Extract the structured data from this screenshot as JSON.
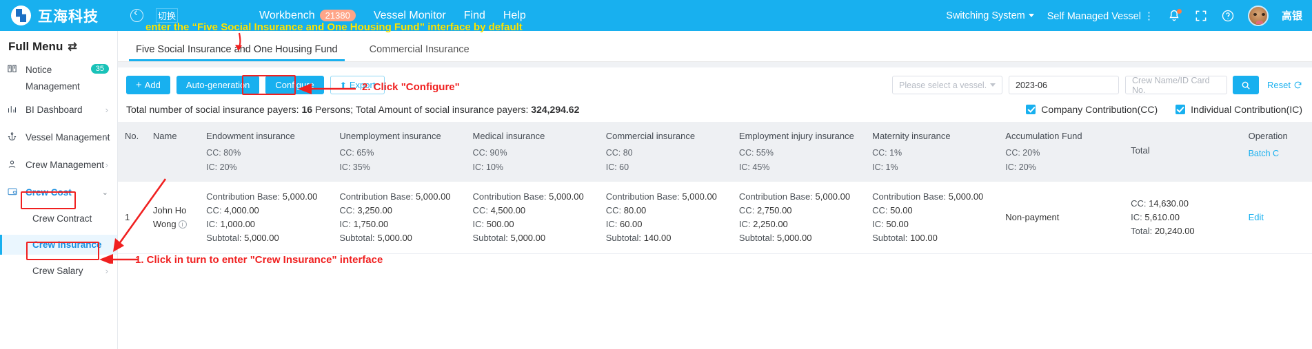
{
  "topbar": {
    "logo_text": "互海科技",
    "switch_label": "切换",
    "nav": [
      {
        "label": "Workbench",
        "badge": "21380"
      },
      {
        "label": "Vessel Monitor",
        "badge": ""
      },
      {
        "label": "Find",
        "badge": ""
      },
      {
        "label": "Help",
        "badge": ""
      }
    ],
    "switching_system": "Switching System",
    "self_managed_vessel": "Self Managed Vessel",
    "user_name": "高银"
  },
  "sidebar": {
    "title": "Full Menu",
    "items": [
      {
        "label": "Notice",
        "label2": "Management",
        "badge": "35",
        "icon": "book-icon",
        "chevron": ""
      },
      {
        "label": "BI Dashboard",
        "badge": "",
        "icon": "chart-icon",
        "chevron": "right"
      },
      {
        "label": "Vessel Management",
        "badge": "",
        "icon": "anchor-icon",
        "chevron": "right"
      },
      {
        "label": "Crew Management",
        "badge": "",
        "icon": "person-icon",
        "chevron": "right"
      },
      {
        "label": "Crew Cost",
        "badge": "",
        "icon": "wallet-icon",
        "chevron": "down"
      }
    ],
    "sub_items": [
      {
        "label": "Crew Contract",
        "chevron": ""
      },
      {
        "label": "Crew Insurance",
        "chevron": ""
      },
      {
        "label": "Crew Salary",
        "chevron": "right"
      }
    ]
  },
  "tabs": [
    {
      "label": "Five Social Insurance and One Housing Fund",
      "active": true
    },
    {
      "label": "Commercial Insurance",
      "active": false
    }
  ],
  "toolbar": {
    "add_label": "Add",
    "auto_generation_label": "Auto-generation",
    "configure_label": "Configure",
    "export_label": "Export",
    "vessel_placeholder": "Please select a vessel.",
    "date_value": "2023-06",
    "crew_placeholder": "Crew Name/ID Card No.",
    "reset_label": "Reset"
  },
  "summary": {
    "text_a": "Total number of social insurance payers:",
    "count": "16",
    "text_b": "Persons; Total Amount of social insurance payers:",
    "amount": "324,294.62",
    "company_contribution": "Company Contribution(CC)",
    "individual_contribution": "Individual Contribution(IC)"
  },
  "table": {
    "columns": [
      {
        "title": "No.",
        "sub1": "",
        "sub2": ""
      },
      {
        "title": "Name",
        "sub1": "",
        "sub2": ""
      },
      {
        "title": "Endowment insurance",
        "sub1": "CC: 80%",
        "sub2": "IC: 20%"
      },
      {
        "title": "Unemployment insurance",
        "sub1": "CC: 65%",
        "sub2": "IC: 35%"
      },
      {
        "title": "Medical insurance",
        "sub1": "CC: 90%",
        "sub2": "IC: 10%"
      },
      {
        "title": "Commercial insurance",
        "sub1": "CC: 80",
        "sub2": "IC: 60"
      },
      {
        "title": "Employment injury insurance",
        "sub1": "CC: 55%",
        "sub2": "IC: 45%"
      },
      {
        "title": "Maternity insurance",
        "sub1": "CC: 1%",
        "sub2": "IC: 1%"
      },
      {
        "title": "Accumulation Fund",
        "sub1": "CC: 20%",
        "sub2": "IC: 20%"
      },
      {
        "title": "Total",
        "sub1": "",
        "sub2": ""
      },
      {
        "title": "Operation",
        "sub1": "Batch C",
        "sub2": ""
      }
    ],
    "rows": [
      {
        "no": "1",
        "name": "John Ho Wong",
        "endowment": {
          "base_k": "Contribution Base:",
          "base_v": "5,000.00",
          "cc_k": "CC:",
          "cc_v": "4,000.00",
          "ic_k": "IC:",
          "ic_v": "1,000.00",
          "sub_k": "Subtotal:",
          "sub_v": "5,000.00"
        },
        "unemployment": {
          "base_k": "Contribution Base:",
          "base_v": "5,000.00",
          "cc_k": "CC:",
          "cc_v": "3,250.00",
          "ic_k": "IC:",
          "ic_v": "1,750.00",
          "sub_k": "Subtotal:",
          "sub_v": "5,000.00"
        },
        "medical": {
          "base_k": "Contribution Base:",
          "base_v": "5,000.00",
          "cc_k": "CC:",
          "cc_v": "4,500.00",
          "ic_k": "IC:",
          "ic_v": "500.00",
          "sub_k": "Subtotal:",
          "sub_v": "5,000.00"
        },
        "commercial": {
          "base_k": "Contribution Base:",
          "base_v": "5,000.00",
          "cc_k": "CC:",
          "cc_v": "80.00",
          "ic_k": "IC:",
          "ic_v": "60.00",
          "sub_k": "Subtotal:",
          "sub_v": "140.00"
        },
        "injury": {
          "base_k": "Contribution Base:",
          "base_v": "5,000.00",
          "cc_k": "CC:",
          "cc_v": "2,750.00",
          "ic_k": "IC:",
          "ic_v": "2,250.00",
          "sub_k": "Subtotal:",
          "sub_v": "5,000.00"
        },
        "maternity": {
          "base_k": "Contribution Base:",
          "base_v": "5,000.00",
          "cc_k": "CC:",
          "cc_v": "50.00",
          "ic_k": "IC:",
          "ic_v": "50.00",
          "sub_k": "Subtotal:",
          "sub_v": "100.00"
        },
        "fund": "Non-payment",
        "total": {
          "cc_k": "CC:",
          "cc_v": "14,630.00",
          "ic_k": "IC:",
          "ic_v": "5,610.00",
          "tot_k": "Total:",
          "tot_v": "20,240.00"
        },
        "operation": "Edit"
      }
    ]
  },
  "annotations": {
    "top_note": "enter the  “Five Social Insurance and One Housing Fund”  interface by default",
    "step2": "2. Click \"Configure\"",
    "step1": "1. Click in turn to enter \"Crew Insurance\" interface"
  }
}
